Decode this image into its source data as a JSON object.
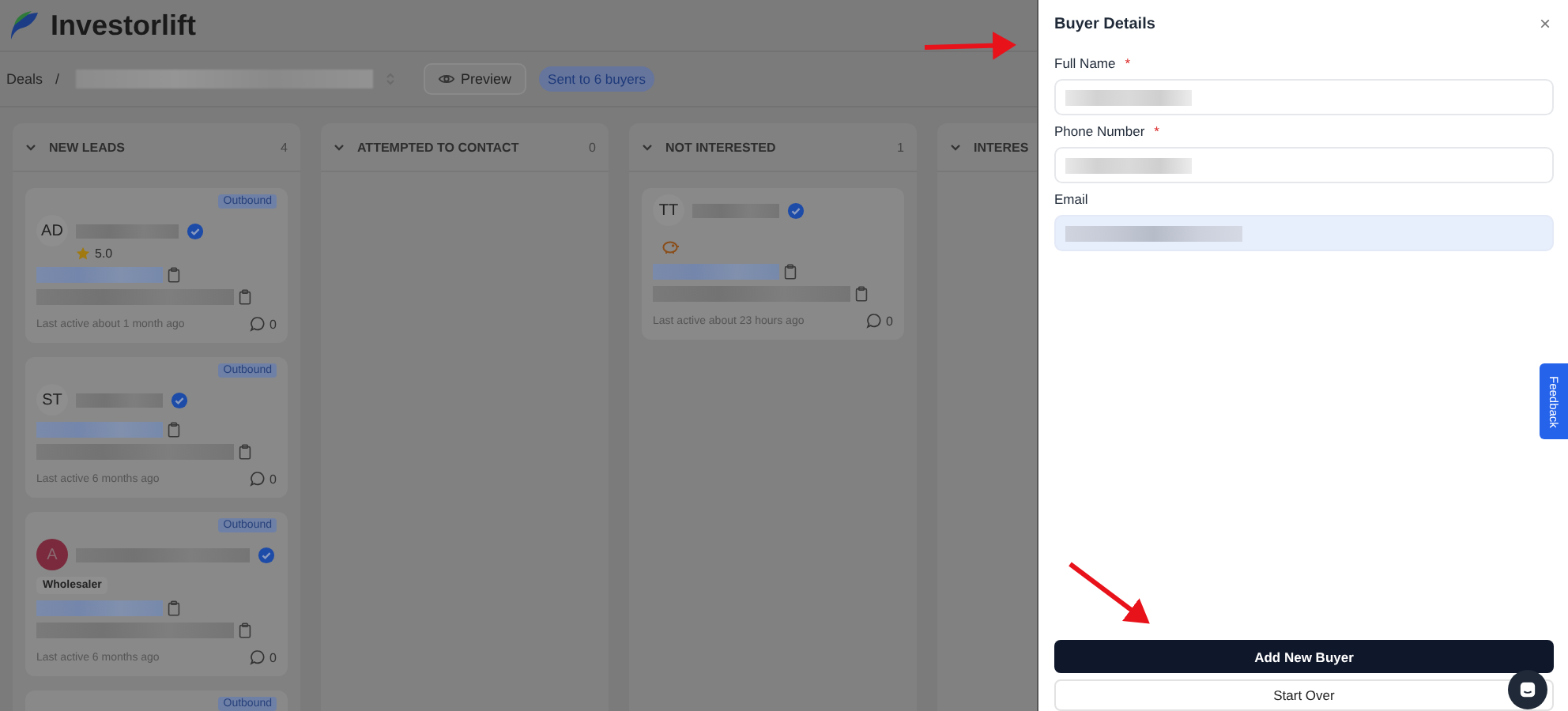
{
  "app": {
    "brand": "Investorlift"
  },
  "breadcrumb": {
    "root": "Deals",
    "separator": "/"
  },
  "preview_button": "Preview",
  "sent_badge": "Sent to 6 buyers",
  "columns": [
    {
      "title": "NEW LEADS",
      "count": "4",
      "cards": [
        {
          "initials": "AD",
          "badge": "Outbound",
          "rating": "5.0",
          "last_active": "Last active about 1 month ago",
          "comments": "0"
        },
        {
          "initials": "ST",
          "badge": "Outbound",
          "last_active": "Last active 6 months ago",
          "comments": "0"
        },
        {
          "initials": "A",
          "color": "#7a2a3c",
          "badge": "Outbound",
          "tag": "Wholesaler",
          "last_active": "Last active 6 months ago",
          "comments": "0"
        },
        {
          "badge": "Outbound"
        }
      ]
    },
    {
      "title": "ATTEMPTED TO CONTACT",
      "count": "0"
    },
    {
      "title": "NOT INTERESTED",
      "count": "1",
      "cards": [
        {
          "initials": "TT",
          "piggy": true,
          "last_active": "Last active about 23 hours ago",
          "comments": "0"
        }
      ]
    },
    {
      "title": "INTERES"
    }
  ],
  "drawer": {
    "title": "Buyer Details",
    "close": "×",
    "fields": [
      {
        "label": "Full Name",
        "required_mark": "*",
        "autofilled": false
      },
      {
        "label": "Phone Number",
        "required_mark": "*",
        "autofilled": false
      },
      {
        "label": "Email",
        "autofilled": true
      }
    ],
    "primary_button": "Add New Buyer",
    "secondary_button": "Start Over"
  },
  "feedback_tab": "Feedback"
}
